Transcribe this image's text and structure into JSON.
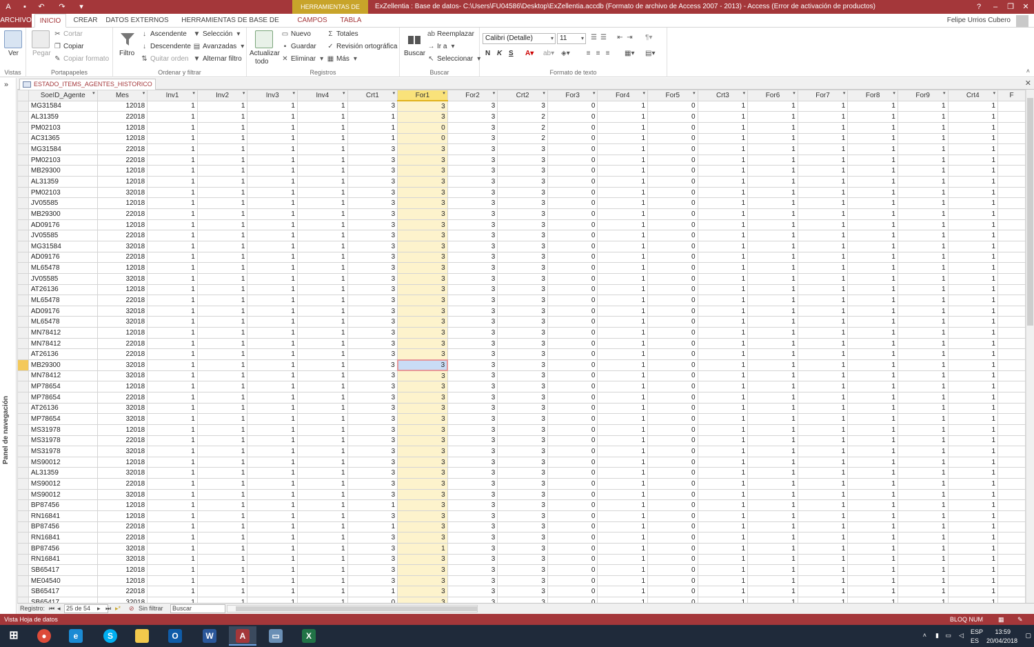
{
  "titlebar": {
    "context_tab": "HERRAMIENTAS DE TABLA",
    "title": "ExZellentia : Base de datos- C:\\Users\\FU04586\\Desktop\\ExZellentia.accdb (Formato de archivo de Access 2007 - 2013) -  Access (Error de activación de productos)",
    "help": "?",
    "user": "Felipe Urrios Cubero"
  },
  "tabs": [
    "ARCHIVO",
    "INICIO",
    "CREAR",
    "DATOS EXTERNOS",
    "HERRAMIENTAS DE BASE DE DATOS",
    "CAMPOS",
    "TABLA"
  ],
  "ribbon": {
    "vistas": {
      "ver": "Ver",
      "label": "Vistas"
    },
    "portapapeles": {
      "pegar": "Pegar",
      "cortar": "Cortar",
      "copiar": "Copiar",
      "copiar_formato": "Copiar formato",
      "label": "Portapapeles"
    },
    "ordenar": {
      "filtro": "Filtro",
      "ascendente": "Ascendente",
      "descendente": "Descendente",
      "quitar_orden": "Quitar orden",
      "seleccion": "Selección",
      "avanzadas": "Avanzadas",
      "alternar_filtro": "Alternar filtro",
      "label": "Ordenar y filtrar"
    },
    "registros": {
      "actualizar": "Actualizar",
      "todo": "todo",
      "nuevo": "Nuevo",
      "guardar": "Guardar",
      "eliminar": "Eliminar",
      "totales": "Totales",
      "revision": "Revisión ortográfica",
      "mas": "Más",
      "label": "Registros"
    },
    "buscar": {
      "buscar": "Buscar",
      "reemplazar": "Reemplazar",
      "ir_a": "Ir a",
      "seleccionar": "Seleccionar",
      "label": "Buscar"
    },
    "formato": {
      "font": "Calibri (Detalle)",
      "size": "11",
      "bold": "N",
      "italic": "K",
      "underline": "S",
      "label": "Formato de texto"
    }
  },
  "nav_pane": {
    "label": "Panel de navegación"
  },
  "doc_tab": "ESTADO_ITEMS_AGENTES_HISTORICO",
  "columns": [
    "SoeID_Agente",
    "Mes",
    "Inv1",
    "Inv2",
    "Inv3",
    "Inv4",
    "Crt1",
    "For1",
    "For2",
    "Crt2",
    "For3",
    "For4",
    "For5",
    "Crt3",
    "For6",
    "For7",
    "For8",
    "For9",
    "Crt4",
    "F"
  ],
  "rows": [
    [
      "MG31584",
      "12018",
      "1",
      "1",
      "1",
      "1",
      "3",
      "3",
      "3",
      "3",
      "0",
      "1",
      "0",
      "1",
      "1",
      "1",
      "1",
      "1",
      "1"
    ],
    [
      "AL31359",
      "22018",
      "1",
      "1",
      "1",
      "1",
      "1",
      "3",
      "3",
      "2",
      "0",
      "1",
      "0",
      "1",
      "1",
      "1",
      "1",
      "1",
      "1"
    ],
    [
      "PM02103",
      "12018",
      "1",
      "1",
      "1",
      "1",
      "1",
      "0",
      "3",
      "2",
      "0",
      "1",
      "0",
      "1",
      "1",
      "1",
      "1",
      "1",
      "1"
    ],
    [
      "AC31365",
      "12018",
      "1",
      "1",
      "1",
      "1",
      "1",
      "0",
      "3",
      "2",
      "0",
      "1",
      "0",
      "1",
      "1",
      "1",
      "1",
      "1",
      "1"
    ],
    [
      "MG31584",
      "22018",
      "1",
      "1",
      "1",
      "1",
      "3",
      "3",
      "3",
      "3",
      "0",
      "1",
      "0",
      "1",
      "1",
      "1",
      "1",
      "1",
      "1"
    ],
    [
      "PM02103",
      "22018",
      "1",
      "1",
      "1",
      "1",
      "3",
      "3",
      "3",
      "3",
      "0",
      "1",
      "0",
      "1",
      "1",
      "1",
      "1",
      "1",
      "1"
    ],
    [
      "MB29300",
      "12018",
      "1",
      "1",
      "1",
      "1",
      "3",
      "3",
      "3",
      "3",
      "0",
      "1",
      "0",
      "1",
      "1",
      "1",
      "1",
      "1",
      "1"
    ],
    [
      "AL31359",
      "12018",
      "1",
      "1",
      "1",
      "1",
      "3",
      "3",
      "3",
      "3",
      "0",
      "1",
      "0",
      "1",
      "1",
      "1",
      "1",
      "1",
      "1"
    ],
    [
      "PM02103",
      "32018",
      "1",
      "1",
      "1",
      "1",
      "3",
      "3",
      "3",
      "3",
      "0",
      "1",
      "0",
      "1",
      "1",
      "1",
      "1",
      "1",
      "1"
    ],
    [
      "JV05585",
      "12018",
      "1",
      "1",
      "1",
      "1",
      "3",
      "3",
      "3",
      "3",
      "0",
      "1",
      "0",
      "1",
      "1",
      "1",
      "1",
      "1",
      "1"
    ],
    [
      "MB29300",
      "22018",
      "1",
      "1",
      "1",
      "1",
      "3",
      "3",
      "3",
      "3",
      "0",
      "1",
      "0",
      "1",
      "1",
      "1",
      "1",
      "1",
      "1"
    ],
    [
      "AD09176",
      "12018",
      "1",
      "1",
      "1",
      "1",
      "3",
      "3",
      "3",
      "3",
      "0",
      "1",
      "0",
      "1",
      "1",
      "1",
      "1",
      "1",
      "1"
    ],
    [
      "JV05585",
      "22018",
      "1",
      "1",
      "1",
      "1",
      "3",
      "3",
      "3",
      "3",
      "0",
      "1",
      "0",
      "1",
      "1",
      "1",
      "1",
      "1",
      "1"
    ],
    [
      "MG31584",
      "32018",
      "1",
      "1",
      "1",
      "1",
      "3",
      "3",
      "3",
      "3",
      "0",
      "1",
      "0",
      "1",
      "1",
      "1",
      "1",
      "1",
      "1"
    ],
    [
      "AD09176",
      "22018",
      "1",
      "1",
      "1",
      "1",
      "3",
      "3",
      "3",
      "3",
      "0",
      "1",
      "0",
      "1",
      "1",
      "1",
      "1",
      "1",
      "1"
    ],
    [
      "ML65478",
      "12018",
      "1",
      "1",
      "1",
      "1",
      "3",
      "3",
      "3",
      "3",
      "0",
      "1",
      "0",
      "1",
      "1",
      "1",
      "1",
      "1",
      "1"
    ],
    [
      "JV05585",
      "32018",
      "1",
      "1",
      "1",
      "1",
      "3",
      "3",
      "3",
      "3",
      "0",
      "1",
      "0",
      "1",
      "1",
      "1",
      "1",
      "1",
      "1"
    ],
    [
      "AT26136",
      "12018",
      "1",
      "1",
      "1",
      "1",
      "3",
      "3",
      "3",
      "3",
      "0",
      "1",
      "0",
      "1",
      "1",
      "1",
      "1",
      "1",
      "1"
    ],
    [
      "ML65478",
      "22018",
      "1",
      "1",
      "1",
      "1",
      "3",
      "3",
      "3",
      "3",
      "0",
      "1",
      "0",
      "1",
      "1",
      "1",
      "1",
      "1",
      "1"
    ],
    [
      "AD09176",
      "32018",
      "1",
      "1",
      "1",
      "1",
      "3",
      "3",
      "3",
      "3",
      "0",
      "1",
      "0",
      "1",
      "1",
      "1",
      "1",
      "1",
      "1"
    ],
    [
      "ML65478",
      "32018",
      "1",
      "1",
      "1",
      "1",
      "3",
      "3",
      "3",
      "3",
      "0",
      "1",
      "0",
      "1",
      "1",
      "1",
      "1",
      "1",
      "1"
    ],
    [
      "MN78412",
      "12018",
      "1",
      "1",
      "1",
      "1",
      "3",
      "3",
      "3",
      "3",
      "0",
      "1",
      "0",
      "1",
      "1",
      "1",
      "1",
      "1",
      "1"
    ],
    [
      "MN78412",
      "22018",
      "1",
      "1",
      "1",
      "1",
      "3",
      "3",
      "3",
      "3",
      "0",
      "1",
      "0",
      "1",
      "1",
      "1",
      "1",
      "1",
      "1"
    ],
    [
      "AT26136",
      "22018",
      "1",
      "1",
      "1",
      "1",
      "3",
      "3",
      "3",
      "3",
      "0",
      "1",
      "0",
      "1",
      "1",
      "1",
      "1",
      "1",
      "1"
    ],
    [
      "MB29300",
      "32018",
      "1",
      "1",
      "1",
      "1",
      "3",
      "3",
      "3",
      "3",
      "0",
      "1",
      "0",
      "1",
      "1",
      "1",
      "1",
      "1",
      "1"
    ],
    [
      "MN78412",
      "32018",
      "1",
      "1",
      "1",
      "1",
      "3",
      "3",
      "3",
      "3",
      "0",
      "1",
      "0",
      "1",
      "1",
      "1",
      "1",
      "1",
      "1"
    ],
    [
      "MP78654",
      "12018",
      "1",
      "1",
      "1",
      "1",
      "3",
      "3",
      "3",
      "3",
      "0",
      "1",
      "0",
      "1",
      "1",
      "1",
      "1",
      "1",
      "1"
    ],
    [
      "MP78654",
      "22018",
      "1",
      "1",
      "1",
      "1",
      "3",
      "3",
      "3",
      "3",
      "0",
      "1",
      "0",
      "1",
      "1",
      "1",
      "1",
      "1",
      "1"
    ],
    [
      "AT26136",
      "32018",
      "1",
      "1",
      "1",
      "1",
      "3",
      "3",
      "3",
      "3",
      "0",
      "1",
      "0",
      "1",
      "1",
      "1",
      "1",
      "1",
      "1"
    ],
    [
      "MP78654",
      "32018",
      "1",
      "1",
      "1",
      "1",
      "3",
      "3",
      "3",
      "3",
      "0",
      "1",
      "0",
      "1",
      "1",
      "1",
      "1",
      "1",
      "1"
    ],
    [
      "MS31978",
      "12018",
      "1",
      "1",
      "1",
      "1",
      "3",
      "3",
      "3",
      "3",
      "0",
      "1",
      "0",
      "1",
      "1",
      "1",
      "1",
      "1",
      "1"
    ],
    [
      "MS31978",
      "22018",
      "1",
      "1",
      "1",
      "1",
      "3",
      "3",
      "3",
      "3",
      "0",
      "1",
      "0",
      "1",
      "1",
      "1",
      "1",
      "1",
      "1"
    ],
    [
      "MS31978",
      "32018",
      "1",
      "1",
      "1",
      "1",
      "3",
      "3",
      "3",
      "3",
      "0",
      "1",
      "0",
      "1",
      "1",
      "1",
      "1",
      "1",
      "1"
    ],
    [
      "MS90012",
      "12018",
      "1",
      "1",
      "1",
      "1",
      "3",
      "3",
      "3",
      "3",
      "0",
      "1",
      "0",
      "1",
      "1",
      "1",
      "1",
      "1",
      "1"
    ],
    [
      "AL31359",
      "32018",
      "1",
      "1",
      "1",
      "1",
      "3",
      "3",
      "3",
      "3",
      "0",
      "1",
      "0",
      "1",
      "1",
      "1",
      "1",
      "1",
      "1"
    ],
    [
      "MS90012",
      "22018",
      "1",
      "1",
      "1",
      "1",
      "3",
      "3",
      "3",
      "3",
      "0",
      "1",
      "0",
      "1",
      "1",
      "1",
      "1",
      "1",
      "1"
    ],
    [
      "MS90012",
      "32018",
      "1",
      "1",
      "1",
      "1",
      "3",
      "3",
      "3",
      "3",
      "0",
      "1",
      "0",
      "1",
      "1",
      "1",
      "1",
      "1",
      "1"
    ],
    [
      "BP87456",
      "12018",
      "1",
      "1",
      "1",
      "1",
      "1",
      "3",
      "3",
      "3",
      "0",
      "1",
      "0",
      "1",
      "1",
      "1",
      "1",
      "1",
      "1"
    ],
    [
      "RN16841",
      "12018",
      "1",
      "1",
      "1",
      "1",
      "3",
      "3",
      "3",
      "3",
      "0",
      "1",
      "0",
      "1",
      "1",
      "1",
      "1",
      "1",
      "1"
    ],
    [
      "BP87456",
      "22018",
      "1",
      "1",
      "1",
      "1",
      "1",
      "3",
      "3",
      "3",
      "0",
      "1",
      "0",
      "1",
      "1",
      "1",
      "1",
      "1",
      "1"
    ],
    [
      "RN16841",
      "22018",
      "1",
      "1",
      "1",
      "1",
      "3",
      "3",
      "3",
      "3",
      "0",
      "1",
      "0",
      "1",
      "1",
      "1",
      "1",
      "1",
      "1"
    ],
    [
      "BP87456",
      "32018",
      "1",
      "1",
      "1",
      "1",
      "3",
      "1",
      "3",
      "3",
      "0",
      "1",
      "0",
      "1",
      "1",
      "1",
      "1",
      "1",
      "1"
    ],
    [
      "RN16841",
      "32018",
      "1",
      "1",
      "1",
      "1",
      "3",
      "3",
      "3",
      "3",
      "0",
      "1",
      "0",
      "1",
      "1",
      "1",
      "1",
      "1",
      "1"
    ],
    [
      "SB65417",
      "12018",
      "1",
      "1",
      "1",
      "1",
      "3",
      "3",
      "3",
      "3",
      "0",
      "1",
      "0",
      "1",
      "1",
      "1",
      "1",
      "1",
      "1"
    ],
    [
      "ME04540",
      "12018",
      "1",
      "1",
      "1",
      "1",
      "3",
      "3",
      "3",
      "3",
      "0",
      "1",
      "0",
      "1",
      "1",
      "1",
      "1",
      "1",
      "1"
    ],
    [
      "SB65417",
      "22018",
      "1",
      "1",
      "1",
      "1",
      "1",
      "3",
      "3",
      "3",
      "0",
      "1",
      "0",
      "1",
      "1",
      "1",
      "1",
      "1",
      "1"
    ],
    [
      "SB65417",
      "32018",
      "1",
      "1",
      "1",
      "1",
      "0",
      "3",
      "3",
      "3",
      "0",
      "1",
      "0",
      "1",
      "1",
      "1",
      "1",
      "1",
      "1"
    ]
  ],
  "current_row": 24,
  "selected_column": "For1",
  "record_nav": {
    "label": "Registro:",
    "position": "25 de 54",
    "filter": "Sin filtrar",
    "search_placeholder": "Buscar"
  },
  "status": {
    "left": "Vista Hoja de datos",
    "right": "BLOQ NUM"
  },
  "tray": {
    "lang1": "ESP",
    "lang2": "ES",
    "time": "13:59",
    "date": "20/04/2018"
  },
  "colors": {
    "accent": "#a4373a",
    "context": "#c8a42a",
    "taskbar": "#1f2a3a"
  }
}
